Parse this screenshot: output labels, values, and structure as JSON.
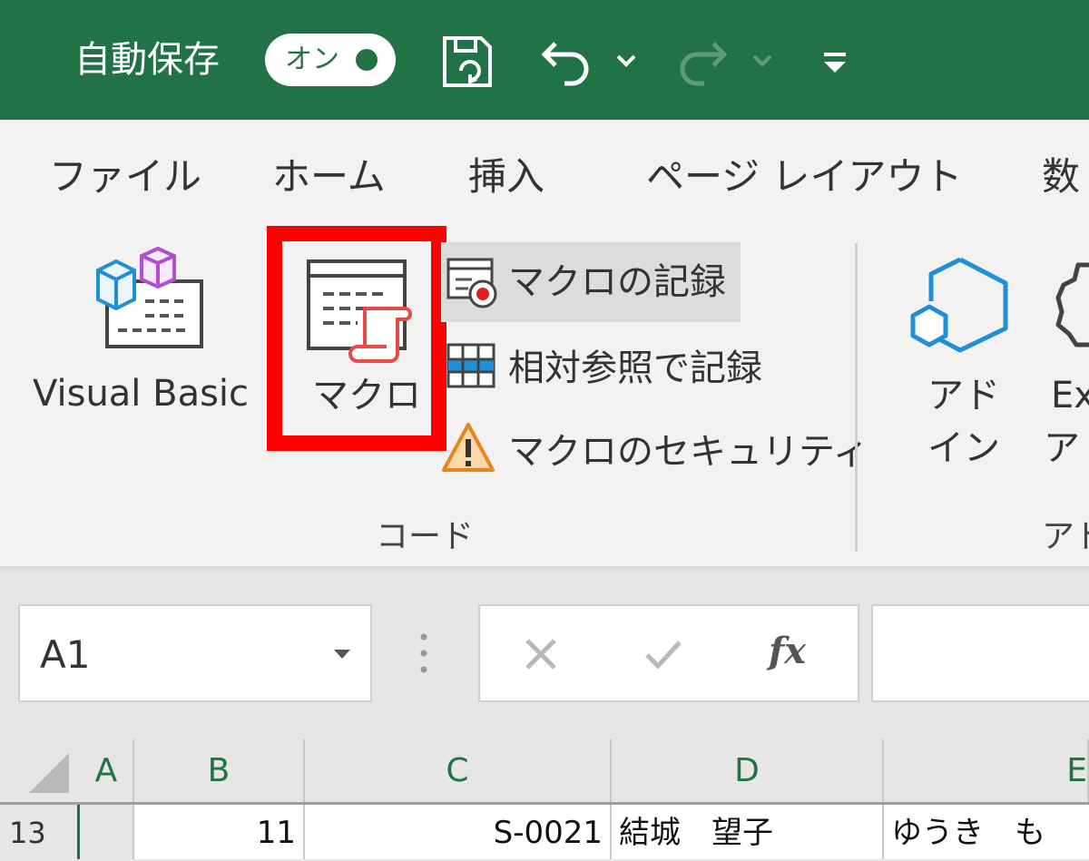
{
  "titlebar": {
    "autosave_label": "自動保存",
    "autosave_state": "オン",
    "icons": [
      "save-icon",
      "undo-icon",
      "chevron-down-icon",
      "redo-icon",
      "chevron-down-icon",
      "customize-qat-icon"
    ],
    "bg_color": "#217346"
  },
  "tabs": [
    "ファイル",
    "ホーム",
    "挿入",
    "ページ レイアウト",
    "数"
  ],
  "ribbon": {
    "code_group": {
      "visual_basic": "Visual Basic",
      "macro": "マクロ",
      "record_macro": "マクロの記録",
      "relative_refs": "相対参照で記録",
      "macro_security": "マクロのセキュリティ",
      "group_label": "コード"
    },
    "addins_group": {
      "addins_line1": "アド",
      "addins_line2": "イン",
      "excel_addins_line1": "Ex",
      "excel_addins_line2": "アド",
      "group_label": "アド"
    },
    "highlight_color": "#ff0000"
  },
  "formula_bar": {
    "name_box": "A1",
    "fx": "fx"
  },
  "grid": {
    "columns": [
      "A",
      "B",
      "C",
      "D",
      "E"
    ],
    "row": {
      "number": "13",
      "cells": [
        "",
        "11",
        "S-0021",
        "結城　望子",
        "ゆうき　も"
      ]
    }
  }
}
